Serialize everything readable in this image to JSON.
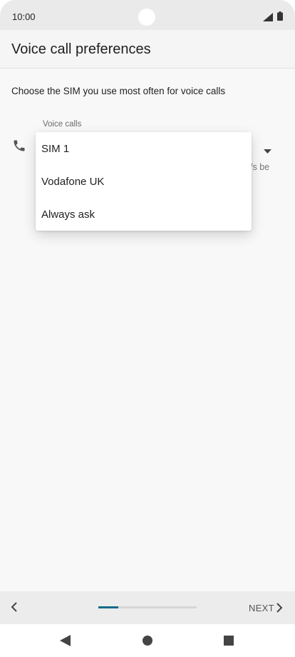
{
  "status_bar": {
    "time": "10:00"
  },
  "header": {
    "title": "Voice call preferences"
  },
  "main": {
    "description": "Choose the SIM you use most often for voice calls",
    "field_label": "Voice calls",
    "partially_hidden_text": "/s be",
    "dropdown_options": [
      "SIM 1",
      "Vodafone UK",
      "Always ask"
    ]
  },
  "wizard": {
    "next_label": "NEXT",
    "progress": 0.2
  },
  "colors": {
    "accent": "#166c8c"
  },
  "icons": {
    "signal": "signal-icon",
    "battery": "battery-icon",
    "phone": "phone-icon",
    "dropdown": "dropdown-arrow-icon",
    "back": "chevron-left-icon",
    "next": "chevron-right-icon",
    "nav_back": "nav-back-icon",
    "nav_home": "nav-home-icon",
    "nav_recents": "nav-recents-icon"
  }
}
